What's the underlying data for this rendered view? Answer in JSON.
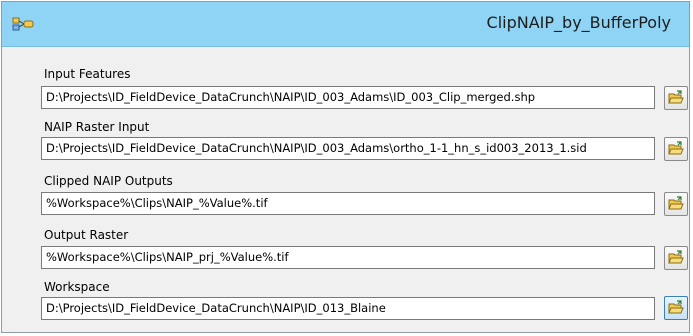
{
  "window": {
    "title": "ClipNAIP_by_BufferPoly"
  },
  "params": [
    {
      "label": "Input Features",
      "value": "D:\\Projects\\ID_FieldDevice_DataCrunch\\NAIP\\ID_003_Adams\\ID_003_Clip_merged.shp"
    },
    {
      "label": "NAIP Raster Input",
      "value": "D:\\Projects\\ID_FieldDevice_DataCrunch\\NAIP\\ID_003_Adams\\ortho_1-1_hn_s_id003_2013_1.sid"
    },
    {
      "label": "Clipped NAIP Outputs",
      "value": "%Workspace%\\Clips\\NAIP_%Value%.tif"
    },
    {
      "label": "Output Raster",
      "value": "%Workspace%\\Clips\\NAIP_prj_%Value%.tif"
    },
    {
      "label": "Workspace",
      "value": "D:\\Projects\\ID_FieldDevice_DataCrunch\\NAIP\\ID_013_Blaine"
    }
  ],
  "icons": {
    "model": "model-tool-icon",
    "browse": "open-folder-icon"
  },
  "colors": {
    "titlebar": "#8fd4f5",
    "panel": "#f0f0f0",
    "folder": "#f2c94c"
  }
}
